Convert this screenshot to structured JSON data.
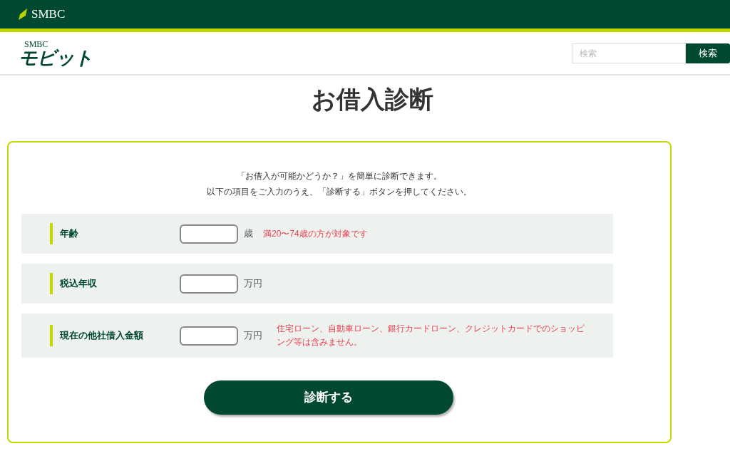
{
  "top_bar": {
    "brand": "SMBC"
  },
  "header": {
    "logo_top": "SMBC",
    "logo_main": "モビット",
    "search": {
      "placeholder": "検索",
      "button": "検索"
    }
  },
  "title": "お借入診断",
  "intro": [
    "「お借入が可能かどうか？」を簡単に診断できます。",
    "以下の項目をご入力のうえ、「診断する」ボタンを押してください。"
  ],
  "fields": [
    {
      "label": "年齢",
      "unit": "歳",
      "note": "満20〜74歳の方が対象です"
    },
    {
      "label": "税込年収",
      "unit": "万円"
    },
    {
      "label": "現在の他社借入金額",
      "unit": "万円",
      "note": "住宅ローン、自動車ローン、銀行カードローン、クレジットカードでのショッピング等は含みません。"
    }
  ],
  "submit": "診断する"
}
